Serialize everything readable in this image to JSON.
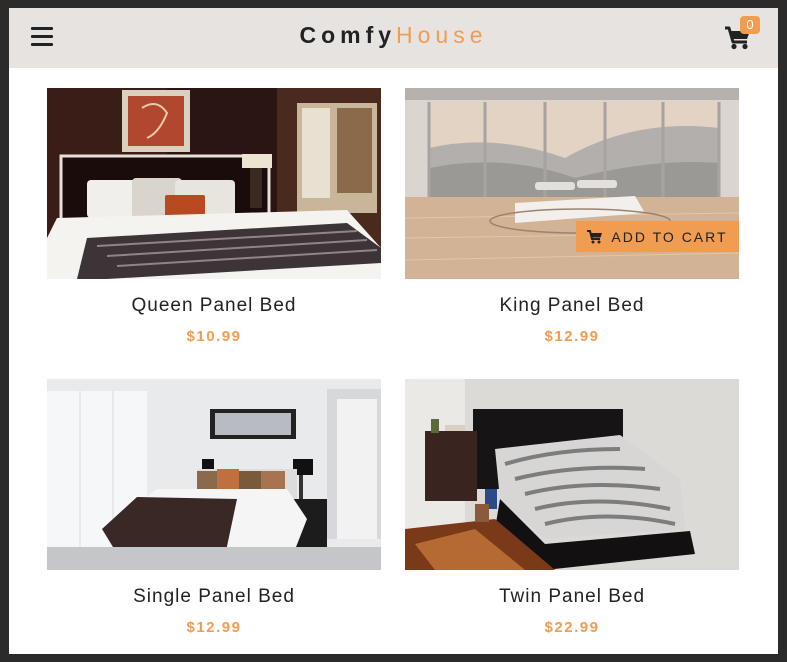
{
  "navbar": {
    "logo_main": "Comfy",
    "logo_accent": "House",
    "cart_count": "0",
    "menu_icon": "hamburger-menu-icon",
    "cart_icon": "shopping-cart-icon"
  },
  "colors": {
    "accent": "#f09d51",
    "navbar_bg": "#e7e3e0",
    "text": "#222222"
  },
  "products": [
    {
      "name": "Queen Panel Bed",
      "price": "$10.99"
    },
    {
      "name": "King Panel Bed",
      "price": "$12.99",
      "button_label": "ADD TO CART",
      "button_icon": "shopping-cart-icon"
    },
    {
      "name": "Single Panel Bed",
      "price": "$12.99"
    },
    {
      "name": "Twin Panel Bed",
      "price": "$22.99"
    }
  ]
}
